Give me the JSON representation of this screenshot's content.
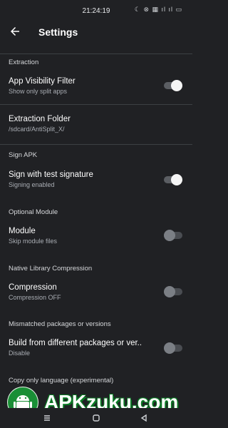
{
  "status_bar": {
    "time": "21:24:19",
    "icons": "☾ ⊗ ▦ ıl ıl ▭"
  },
  "toolbar": {
    "title": "Settings"
  },
  "sections": [
    {
      "category": "Extraction",
      "items": [
        {
          "title": "App Visibility Filter",
          "summary": "Show only split apps",
          "switch": "on"
        },
        {
          "title": "Extraction Folder",
          "summary": "/sdcard/AntiSplit_X/"
        }
      ]
    },
    {
      "category": "Sign APK",
      "items": [
        {
          "title": "Sign with test signature",
          "summary": "Signing enabled",
          "switch": "on"
        }
      ]
    },
    {
      "category": "Optional Module",
      "items": [
        {
          "title": "Module",
          "summary": "Skip module files",
          "switch": "off"
        }
      ]
    },
    {
      "category": "Native Library Compression",
      "items": [
        {
          "title": "Compression",
          "summary": "Compression OFF",
          "switch": "off"
        }
      ]
    },
    {
      "category": "Mismatched packages or versions",
      "items": [
        {
          "title": "Build from different packages or ver..",
          "summary": "Disable",
          "switch": "off"
        }
      ]
    },
    {
      "category": "Copy only language (experimental)",
      "items": []
    }
  ],
  "watermark": {
    "text": "APKzuku.com"
  },
  "colors": {
    "background": "#202124",
    "switch_on_thumb": "#f5f5f5",
    "switch_off_thumb": "#7b7f85",
    "watermark_green": "#0b7a25"
  }
}
